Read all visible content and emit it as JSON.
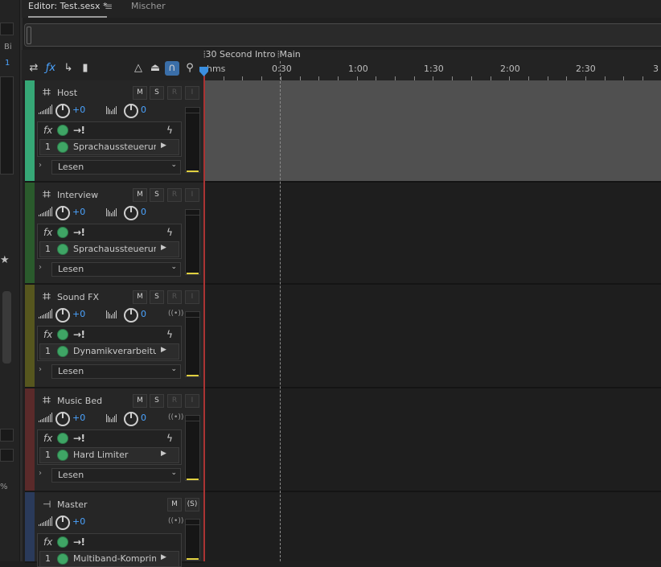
{
  "tabs": {
    "editor": "Editor: Test.sesx *",
    "menu": "≡",
    "mixer": "Mischer"
  },
  "left_panel": {
    "items": [
      "Bi",
      "1",
      "%"
    ]
  },
  "timeline": {
    "markers": [
      "30 Second Intro",
      "Main"
    ],
    "ruler_labels": [
      "hms",
      "0:30",
      "1:00",
      "1:30",
      "2:00",
      "2:30",
      "3"
    ]
  },
  "tracks": [
    {
      "name": "Host",
      "color": "#36a776",
      "vol": "+0",
      "pan": "0",
      "mute": "M",
      "solo": "S",
      "rec": "R",
      "input": "I",
      "fx": "Sprachaussteuerung",
      "slot": "1",
      "automation": "Lesen"
    },
    {
      "name": "Interview",
      "color": "#2a5a2c",
      "vol": "+0",
      "pan": "0",
      "mute": "M",
      "solo": "S",
      "rec": "R",
      "input": "I",
      "fx": "Sprachaussteuerung",
      "slot": "1",
      "automation": "Lesen"
    },
    {
      "name": "Sound FX",
      "color": "#56561e",
      "vol": "+0",
      "pan": "0",
      "mute": "M",
      "solo": "S",
      "rec": "R",
      "input": "I",
      "fx": "Dynamikverarbeitung",
      "slot": "1",
      "automation": "Lesen"
    },
    {
      "name": "Music Bed",
      "color": "#5a2a2a",
      "vol": "+0",
      "pan": "0",
      "mute": "M",
      "solo": "S",
      "rec": "R",
      "input": "I",
      "fx": "Hard Limiter",
      "slot": "1",
      "automation": "Lesen"
    }
  ],
  "master": {
    "name": "Master",
    "vol": "+0",
    "mute": "M",
    "solo": "(S)",
    "fx": "Multiband-Komprim",
    "slot": "1",
    "color": "#2a3a5a"
  },
  "fx_label": "fx"
}
